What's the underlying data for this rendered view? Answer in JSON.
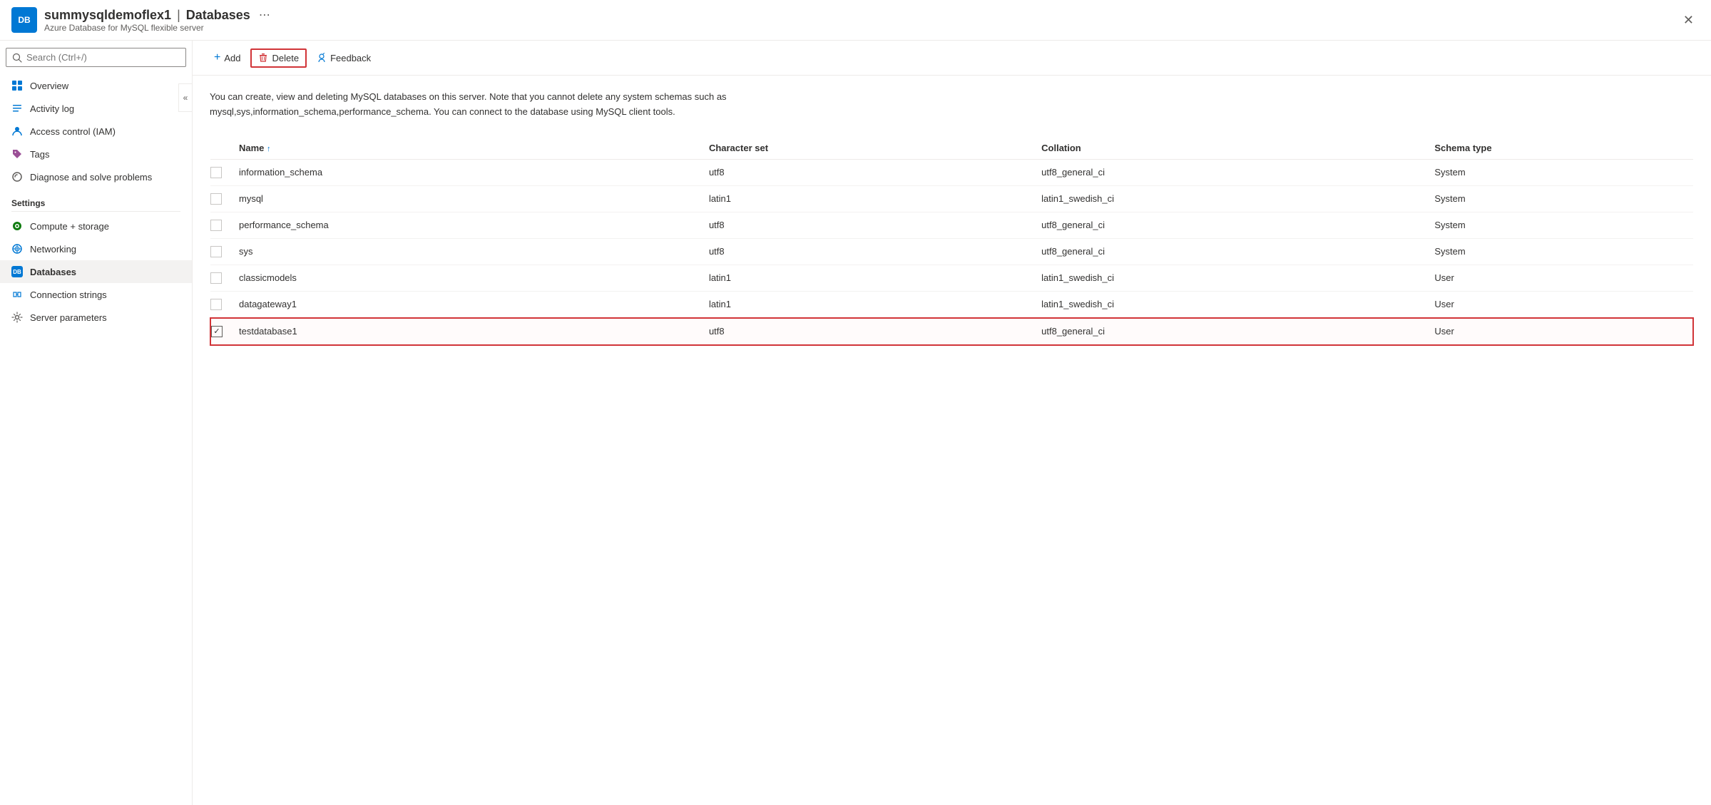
{
  "header": {
    "server_name": "summysqldemoflex1",
    "separator": "|",
    "page_title": "Databases",
    "subtitle": "Azure Database for MySQL flexible server",
    "more_icon": "⋯",
    "close_icon": "✕"
  },
  "search": {
    "placeholder": "Search (Ctrl+/)"
  },
  "sidebar": {
    "collapse_icon": "«",
    "items": [
      {
        "id": "overview",
        "label": "Overview",
        "icon": "overview"
      },
      {
        "id": "activity-log",
        "label": "Activity log",
        "icon": "activity"
      },
      {
        "id": "access-control",
        "label": "Access control (IAM)",
        "icon": "iam"
      },
      {
        "id": "tags",
        "label": "Tags",
        "icon": "tags"
      },
      {
        "id": "diagnose",
        "label": "Diagnose and solve problems",
        "icon": "diagnose"
      }
    ],
    "settings_label": "Settings",
    "settings_items": [
      {
        "id": "compute-storage",
        "label": "Compute + storage",
        "icon": "compute"
      },
      {
        "id": "networking",
        "label": "Networking",
        "icon": "networking"
      },
      {
        "id": "databases",
        "label": "Databases",
        "icon": "databases",
        "active": true
      },
      {
        "id": "connection-strings",
        "label": "Connection strings",
        "icon": "connstrings"
      },
      {
        "id": "server-parameters",
        "label": "Server parameters",
        "icon": "serverparams"
      }
    ]
  },
  "toolbar": {
    "add_label": "Add",
    "delete_label": "Delete",
    "feedback_label": "Feedback"
  },
  "content": {
    "description": "You can create, view and deleting MySQL databases on this server. Note that you cannot delete any system schemas such as mysql,sys,information_schema,performance_schema. You can connect to the database using MySQL client tools.",
    "table": {
      "columns": [
        {
          "id": "name",
          "label": "Name",
          "sortable": true,
          "sort_dir": "asc"
        },
        {
          "id": "charset",
          "label": "Character set"
        },
        {
          "id": "collation",
          "label": "Collation"
        },
        {
          "id": "schema_type",
          "label": "Schema type"
        }
      ],
      "rows": [
        {
          "id": 1,
          "name": "information_schema",
          "charset": "utf8",
          "collation": "utf8_general_ci",
          "schema_type": "System",
          "selected": false,
          "checked": false
        },
        {
          "id": 2,
          "name": "mysql",
          "charset": "latin1",
          "collation": "latin1_swedish_ci",
          "schema_type": "System",
          "selected": false,
          "checked": false
        },
        {
          "id": 3,
          "name": "performance_schema",
          "charset": "utf8",
          "collation": "utf8_general_ci",
          "schema_type": "System",
          "selected": false,
          "checked": false
        },
        {
          "id": 4,
          "name": "sys",
          "charset": "utf8",
          "collation": "utf8_general_ci",
          "schema_type": "System",
          "selected": false,
          "checked": false
        },
        {
          "id": 5,
          "name": "classicmodels",
          "charset": "latin1",
          "collation": "latin1_swedish_ci",
          "schema_type": "User",
          "selected": false,
          "checked": false
        },
        {
          "id": 6,
          "name": "datagateway1",
          "charset": "latin1",
          "collation": "latin1_swedish_ci",
          "schema_type": "User",
          "selected": false,
          "checked": false
        },
        {
          "id": 7,
          "name": "testdatabase1",
          "charset": "utf8",
          "collation": "utf8_general_ci",
          "schema_type": "User",
          "selected": true,
          "checked": true
        }
      ]
    }
  }
}
